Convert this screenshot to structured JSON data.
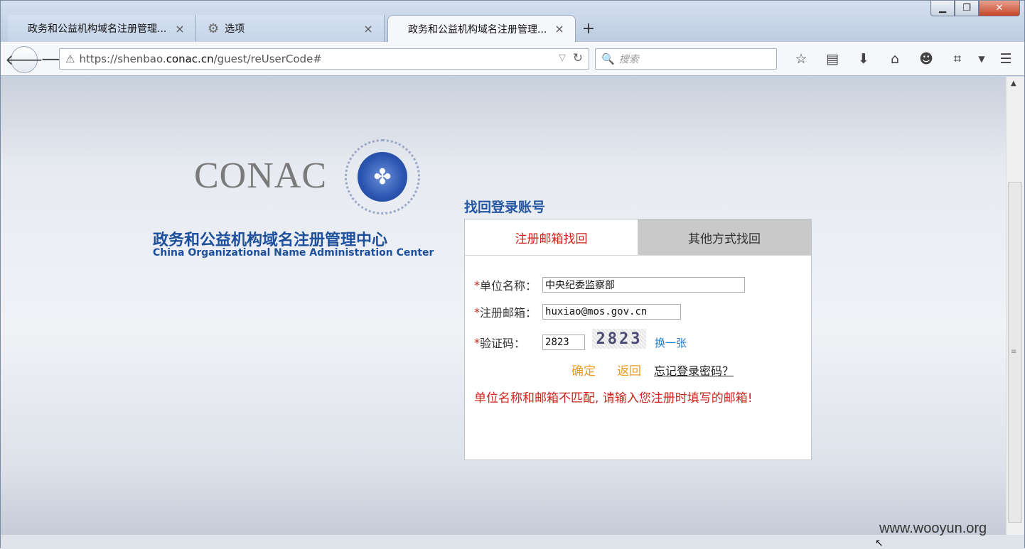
{
  "browser": {
    "tabs": [
      {
        "title": "政务和公益机构域名注册管理...",
        "icon": "none",
        "active": false
      },
      {
        "title": "选项",
        "icon": "gear-icon",
        "active": false
      },
      {
        "title": "政务和公益机构域名注册管理...",
        "icon": "none",
        "active": true
      }
    ],
    "new_tab_label": "+",
    "close_glyph": "×",
    "url": {
      "prefix": "https://shenbao.",
      "host": "conac.cn",
      "path": "/guest/reUserCode#"
    },
    "search_placeholder": "搜索"
  },
  "logo": {
    "wordmark": "CONAC",
    "name_cn": "政务和公益机构域名注册管理中心",
    "name_en": "China Organizational Name Administration Center"
  },
  "form": {
    "title": "找回登录账号",
    "tabs": [
      "注册邮箱找回",
      "其他方式找回"
    ],
    "fields": {
      "unit_name": {
        "label": "单位名称：",
        "value": "中央纪委监察部"
      },
      "email": {
        "label": "注册邮箱：",
        "value": "huxiao@mos.gov.cn"
      },
      "captcha": {
        "label": "验证码：",
        "value": "2823",
        "image_text": "2823",
        "refresh_label": "换一张"
      }
    },
    "required_mark": "*",
    "confirm_label": "确定",
    "back_label": "返回",
    "forgot_label": "忘记登录密码？",
    "error_message": "单位名称和邮箱不匹配, 请输入您注册时填写的邮箱!"
  },
  "watermark": "www.wooyun.org",
  "colors": {
    "accent_red": "#d0241c",
    "brand_blue": "#2457a2",
    "orange": "#f09a1c",
    "link_blue": "#1d7bd0"
  }
}
